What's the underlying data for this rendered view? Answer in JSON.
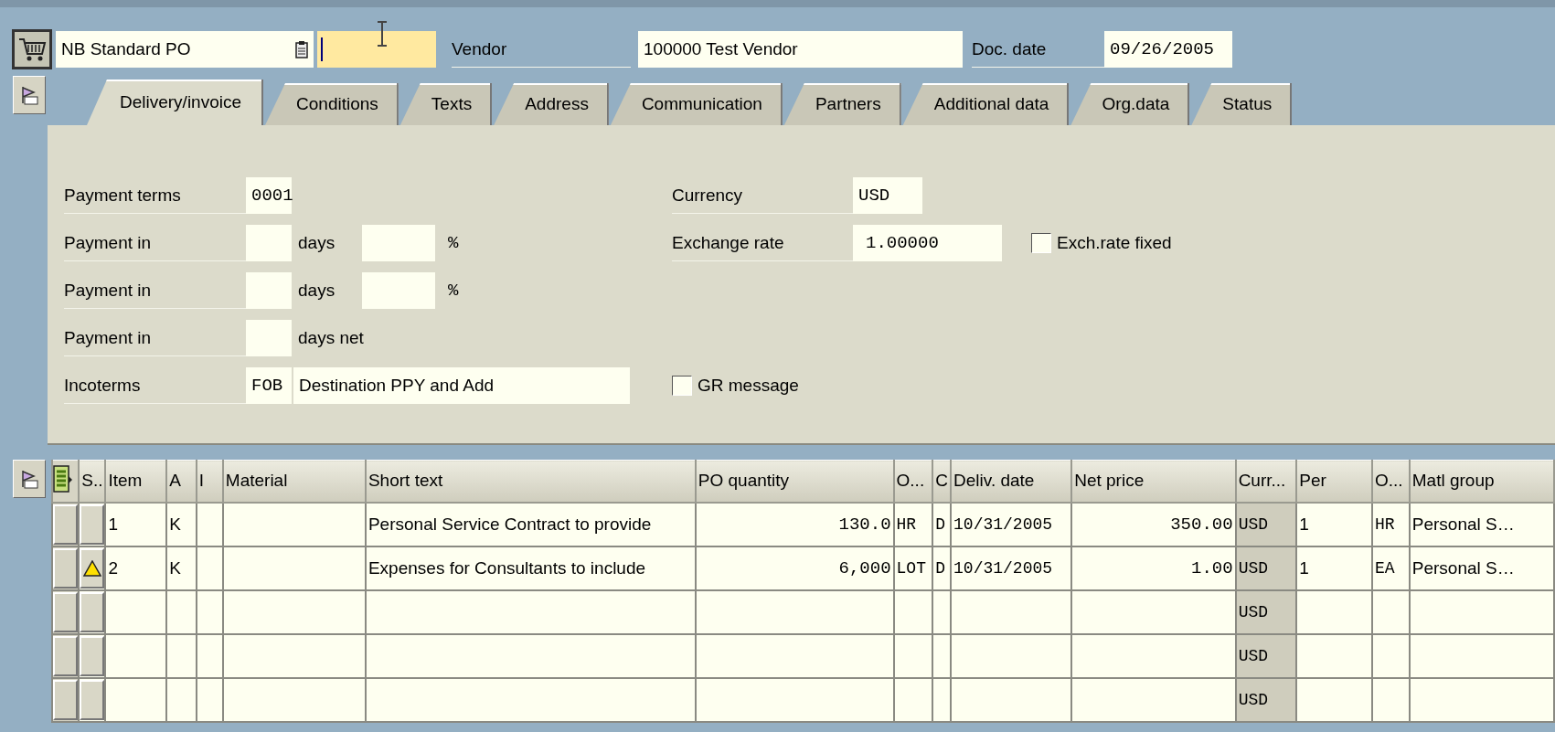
{
  "header": {
    "doc_type": "NB Standard PO",
    "vendor_label": "Vendor",
    "vendor": "100000 Test Vendor",
    "doc_date_label": "Doc. date",
    "doc_date": "09/26/2005"
  },
  "tabs": [
    {
      "label": "Delivery/invoice",
      "selected": true
    },
    {
      "label": "Conditions",
      "selected": false
    },
    {
      "label": "Texts",
      "selected": false
    },
    {
      "label": "Address",
      "selected": false
    },
    {
      "label": "Communication",
      "selected": false
    },
    {
      "label": "Partners",
      "selected": false
    },
    {
      "label": "Additional data",
      "selected": false
    },
    {
      "label": "Org.data",
      "selected": false
    },
    {
      "label": "Status",
      "selected": false
    }
  ],
  "form": {
    "payment_terms": {
      "label": "Payment terms",
      "value": "0001"
    },
    "payment_in": [
      {
        "label": "Payment in",
        "unit": "days",
        "percent_sign": "%"
      },
      {
        "label": "Payment in",
        "unit": "days",
        "percent_sign": "%"
      },
      {
        "label": "Payment in",
        "unit": "days net"
      }
    ],
    "incoterms": {
      "label": "Incoterms",
      "code": "FOB",
      "text": "Destination PPY and Add"
    },
    "currency": {
      "label": "Currency",
      "value": "USD"
    },
    "exchange_rate": {
      "label": "Exchange rate",
      "value": "1.00000"
    },
    "exch_rate_fixed": {
      "label": "Exch.rate fixed",
      "checked": false
    },
    "gr_message": {
      "label": "GR message",
      "checked": false
    }
  },
  "table": {
    "columns": [
      {
        "label": "S..",
        "kind": "status"
      },
      {
        "label": "Item",
        "kind": "text"
      },
      {
        "label": "A",
        "kind": "text"
      },
      {
        "label": "I",
        "kind": "text"
      },
      {
        "label": "Material",
        "kind": "text"
      },
      {
        "label": "Short text",
        "kind": "text"
      },
      {
        "label": "PO quantity",
        "kind": "number"
      },
      {
        "label": "O...",
        "kind": "code"
      },
      {
        "label": "C",
        "kind": "code"
      },
      {
        "label": "Deliv. date",
        "kind": "code"
      },
      {
        "label": "Net price",
        "kind": "number"
      },
      {
        "label": "Curr...",
        "kind": "shaded"
      },
      {
        "label": "Per",
        "kind": "text"
      },
      {
        "label": "O...",
        "kind": "code"
      },
      {
        "label": "Matl group",
        "kind": "text"
      }
    ],
    "rows": [
      {
        "warning": false,
        "cells": {
          "item": "1",
          "a": "K",
          "short_text": "Personal Service Contract to provide",
          "po_quantity": "130.0",
          "order_unit": "HR",
          "c": "D",
          "deliv_date": "10/31/2005",
          "net_price": "350.00",
          "curr": "USD",
          "per": "1",
          "price_unit": "HR",
          "matl_group": "Personal S…"
        }
      },
      {
        "warning": true,
        "cells": {
          "item": "2",
          "a": "K",
          "short_text": "Expenses for Consultants to include",
          "po_quantity": "6,000",
          "order_unit": "LOT",
          "c": "D",
          "deliv_date": "10/31/2005",
          "net_price": "1.00",
          "curr": "USD",
          "per": "1",
          "price_unit": "EA",
          "matl_group": "Personal S…"
        }
      },
      {
        "warning": false,
        "cells": {
          "curr": "USD"
        }
      },
      {
        "warning": false,
        "cells": {
          "curr": "USD"
        }
      },
      {
        "warning": false,
        "cells": {
          "curr": "USD"
        }
      }
    ]
  }
}
